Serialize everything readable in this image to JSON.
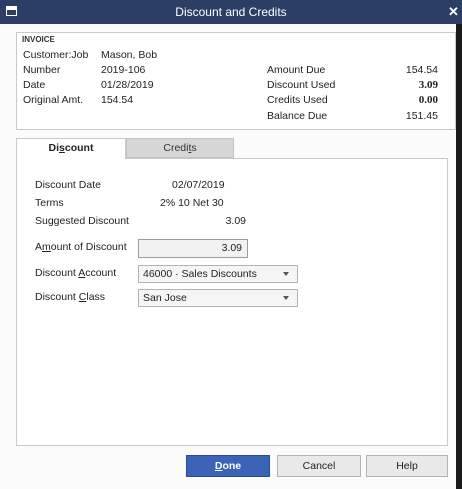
{
  "window": {
    "title": "Discount and Credits"
  },
  "invoice": {
    "heading": "INVOICE",
    "customer_job_label": "Customer:Job",
    "customer_job": "Mason, Bob",
    "number_label": "Number",
    "number": "2019-106",
    "date_label": "Date",
    "date": "01/28/2019",
    "original_amt_label": "Original Amt.",
    "original_amt": "154.54",
    "amount_due_label": "Amount Due",
    "amount_due": "154.54",
    "discount_used_label": "Discount Used",
    "discount_used": "3.09",
    "credits_used_label": "Credits Used",
    "credits_used": "0.00",
    "balance_due_label": "Balance Due",
    "balance_due": "151.45"
  },
  "tabs": {
    "discount": {
      "pre": "Di",
      "key": "s",
      "post": "count"
    },
    "credits": {
      "pre": "Credi",
      "key": "t",
      "post": "s"
    }
  },
  "discount": {
    "discount_date_label": "Discount Date",
    "discount_date": "02/07/2019",
    "terms_label": "Terms",
    "terms": "2% 10 Net 30",
    "suggested_label": "Suggested Discount",
    "suggested": "3.09",
    "amount_label": {
      "pre": "A",
      "key": "m",
      "post": "ount of Discount"
    },
    "amount": "3.09",
    "account_label": {
      "pre": "Discount ",
      "key": "A",
      "post": "ccount"
    },
    "account": "46000 · Sales Discounts",
    "class_label": {
      "pre": "Discount ",
      "key": "C",
      "post": "lass"
    },
    "class": "San Jose"
  },
  "buttons": {
    "done": {
      "pre": "",
      "key": "D",
      "post": "one"
    },
    "cancel": "Cancel",
    "help": "Help"
  }
}
